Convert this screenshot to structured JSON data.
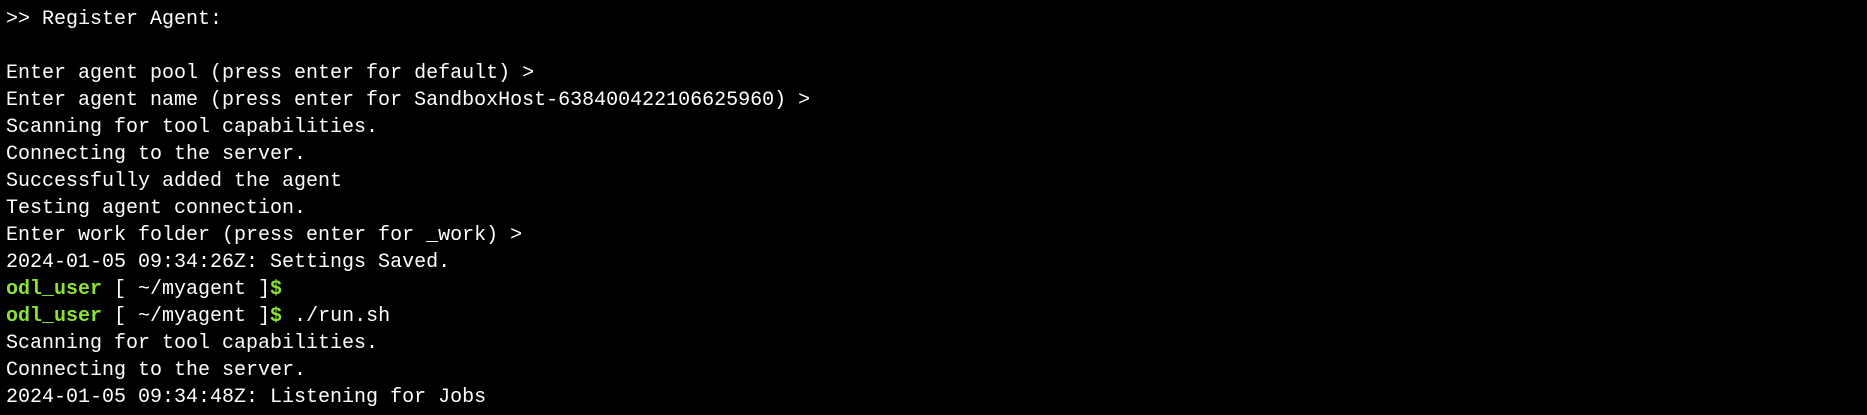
{
  "colors": {
    "background": "#000000",
    "text": "#ffffff",
    "prompt_user": "#8ae234"
  },
  "terminal": {
    "line_0": ">> Register Agent:",
    "line_1": "Enter agent pool (press enter for default) >",
    "line_2": "Enter agent name (press enter for SandboxHost-638400422106625960) >",
    "line_3": "Scanning for tool capabilities.",
    "line_4": "Connecting to the server.",
    "line_5": "Successfully added the agent",
    "line_6": "Testing agent connection.",
    "line_7": "Enter work folder (press enter for _work) >",
    "line_8": "2024-01-05 09:34:26Z: Settings Saved.",
    "prompt_1": {
      "user": "odl_user",
      "path": " [ ~/myagent ]",
      "sign": "$",
      "command": ""
    },
    "prompt_2": {
      "user": "odl_user",
      "path": " [ ~/myagent ]",
      "sign": "$",
      "command": " ./run.sh"
    },
    "line_9": "Scanning for tool capabilities.",
    "line_10": "Connecting to the server.",
    "line_11": "2024-01-05 09:34:48Z: Listening for Jobs"
  }
}
